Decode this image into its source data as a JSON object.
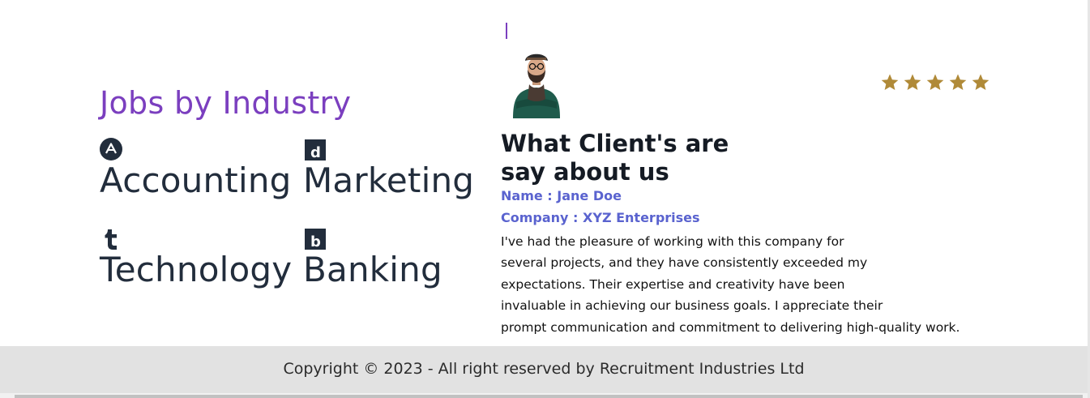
{
  "industry": {
    "title": "Jobs by Industry",
    "items": [
      {
        "label": "Accounting",
        "icon": "a-circle-icon"
      },
      {
        "label": "Marketing",
        "icon": "d-square-icon"
      },
      {
        "label": "Technology",
        "icon": "tumblr-t-icon"
      },
      {
        "label": "Banking",
        "icon": "b-square-icon"
      }
    ]
  },
  "testimonial": {
    "avatar": "man-avatar-image",
    "rating": 5,
    "heading": "What Client's are say about us",
    "name_line": "Name : Jane Doe",
    "company_line": "Company : XYZ Enterprises",
    "lines": [
      "I've had the pleasure of working with this company for",
      "several projects, and they have consistently exceeded my",
      "expectations. Their expertise and creativity have been",
      "invaluable in achieving our business goals. I appreciate their",
      "prompt communication and commitment to delivering high-quality work."
    ]
  },
  "footer": {
    "text": "Copyright © 2023 - All right reserved by Recruitment Industries Ltd"
  },
  "colors": {
    "accent": "#7b3fbf",
    "meta": "#5a63cf",
    "star": "#b08a38",
    "icon": "#222d3c",
    "footer_bg": "#e2e2e2"
  }
}
